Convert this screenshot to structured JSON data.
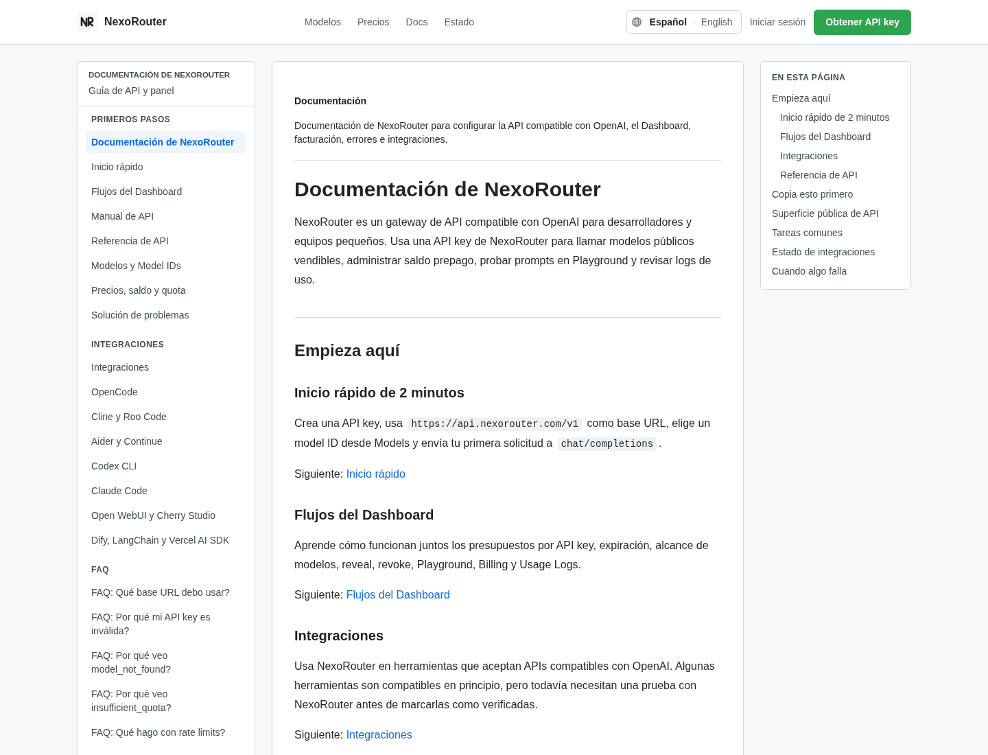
{
  "header": {
    "brand": "NexoRouter",
    "nav": [
      {
        "label": "Modelos"
      },
      {
        "label": "Precios"
      },
      {
        "label": "Docs"
      },
      {
        "label": "Estado"
      }
    ],
    "language_switch": {
      "options": [
        {
          "label": "Español",
          "selected": true
        },
        {
          "label": "English",
          "selected": false
        }
      ],
      "separator": "·"
    },
    "login": "Iniciar sesión",
    "cta": "Obtener API key"
  },
  "sidebar": {
    "title": "DOCUMENTACIÓN DE NEXOROUTER",
    "subtitle": "Guía de API y panel",
    "sections": [
      {
        "heading": "PRIMEROS PASOS",
        "items": [
          {
            "label": "Documentación de NexoRouter",
            "selected": true
          },
          {
            "label": "Inicio rápido",
            "selected": false
          },
          {
            "label": "Flujos del Dashboard",
            "selected": false
          },
          {
            "label": "Manual de API",
            "selected": false
          },
          {
            "label": "Referencia de API",
            "selected": false
          },
          {
            "label": "Modelos y Model IDs",
            "selected": false
          },
          {
            "label": "Precios, saldo y quota",
            "selected": false
          },
          {
            "label": "Solución de problemas",
            "selected": false
          }
        ]
      },
      {
        "heading": "INTEGRACIONES",
        "items": [
          {
            "label": "Integraciones",
            "selected": false
          },
          {
            "label": "OpenCode",
            "selected": false
          },
          {
            "label": "Cline y Roo Code",
            "selected": false
          },
          {
            "label": "Aider y Continue",
            "selected": false
          },
          {
            "label": "Codex CLI",
            "selected": false
          },
          {
            "label": "Claude Code",
            "selected": false
          },
          {
            "label": "Open WebUI y Cherry Studio",
            "selected": false
          },
          {
            "label": "Dify, LangChain y Vercel AI SDK",
            "selected": false
          }
        ]
      },
      {
        "heading": "FAQ",
        "items": [
          {
            "label": "FAQ: Qué base URL debo usar?",
            "selected": false
          },
          {
            "label": "FAQ: Por qué mi API key es inválida?",
            "selected": false
          },
          {
            "label": "FAQ: Por qué veo model_not_found?",
            "selected": false
          },
          {
            "label": "FAQ: Por qué veo insufficient_quota?",
            "selected": false
          },
          {
            "label": "FAQ: Qué hago con rate limits?",
            "selected": false
          }
        ]
      }
    ]
  },
  "main": {
    "eyebrow": "Documentación",
    "description": "Documentación de NexoRouter para configurar la API compatible con OpenAI, el Dashboard, facturación, errores e integraciones.",
    "title": "Documentación de NexoRouter",
    "intro": "NexoRouter es un gateway de API compatible con OpenAI para desarrolladores y equipos pequeños. Usa una API key de NexoRouter para llamar modelos públicos vendibles, administrar saldo prepago, probar prompts en Playground y revisar logs de uso.",
    "sections": [
      {
        "heading": "Empieza aquí",
        "subsections": [
          {
            "heading": "Inicio rápido de 2 minutos",
            "body": [
              {
                "kind": "text",
                "text": "Crea una API key, usa "
              },
              {
                "kind": "code",
                "text": "https://api.nexorouter.com/v1"
              },
              {
                "kind": "text",
                "text": " como base URL, elige un model ID desde Models y envía tu primera solicitud a "
              },
              {
                "kind": "code",
                "text": "chat/completions"
              },
              {
                "kind": "text",
                "text": "."
              }
            ],
            "next": {
              "label": "Siguiente:",
              "link": "Inicio rápido"
            }
          },
          {
            "heading": "Flujos del Dashboard",
            "body": [
              {
                "kind": "text",
                "text": "Aprende cómo funcionan juntos los presupuestos por API key, expiración, alcance de modelos, reveal, revoke, Playground, Billing y Usage Logs."
              }
            ],
            "next": {
              "label": "Siguiente:",
              "link": "Flujos del Dashboard"
            }
          },
          {
            "heading": "Integraciones",
            "body": [
              {
                "kind": "text",
                "text": "Usa NexoRouter en herramientas que aceptan APIs compatibles con OpenAI. Algunas herramientas son compatibles en principio, pero todavía necesitan una prueba con NexoRouter antes de marcarlas como verificadas."
              }
            ],
            "next": {
              "label": "Siguiente:",
              "link": "Integraciones"
            }
          }
        ]
      }
    ]
  },
  "toc": {
    "title": "EN ESTA PÁGINA",
    "items": [
      {
        "label": "Empieza aquí",
        "children": [
          {
            "label": "Inicio rápido de 2 minutos"
          },
          {
            "label": "Flujos del Dashboard"
          },
          {
            "label": "Integraciones"
          },
          {
            "label": "Referencia de API"
          }
        ]
      },
      {
        "label": "Copia esto primero"
      },
      {
        "label": "Superficie pública de API"
      },
      {
        "label": "Tareas comunes"
      },
      {
        "label": "Estado de integraciones"
      },
      {
        "label": "Cuando algo falla"
      }
    ]
  }
}
